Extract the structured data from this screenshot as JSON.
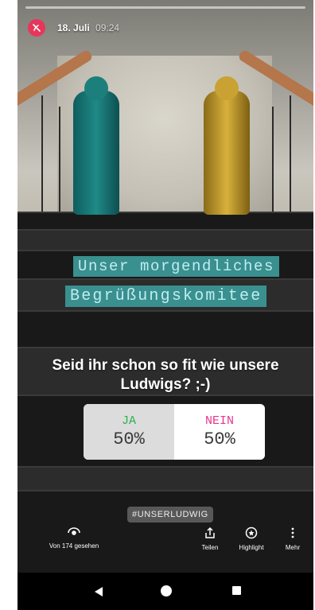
{
  "header": {
    "date": "18. Juli",
    "time": "09:24"
  },
  "story": {
    "text_line1": "Unser morgendliches",
    "text_line2": "Begrüßungskomitee",
    "question_line1": "Seid ihr schon so fit wie unsere",
    "question_line2": "Ludwigs? ;-)"
  },
  "poll": {
    "options": [
      {
        "label": "JA",
        "percent": "50%",
        "color": "#27b34b"
      },
      {
        "label": "NEIN",
        "percent": "50%",
        "color": "#e8368a"
      }
    ]
  },
  "hashtag": "#UNSERLUDWIG",
  "actions": {
    "viewers": "Von 174 gesehen",
    "share": "Teilen",
    "highlight": "Highlight",
    "more": "Mehr"
  },
  "icons": {
    "avatar": "avatar-logo-icon",
    "viewers": "eye-icon",
    "share": "share-icon",
    "highlight": "highlight-icon",
    "more": "more-vertical-icon",
    "back": "back-triangle-icon",
    "home": "home-circle-icon",
    "recent": "recent-apps-square-icon"
  }
}
